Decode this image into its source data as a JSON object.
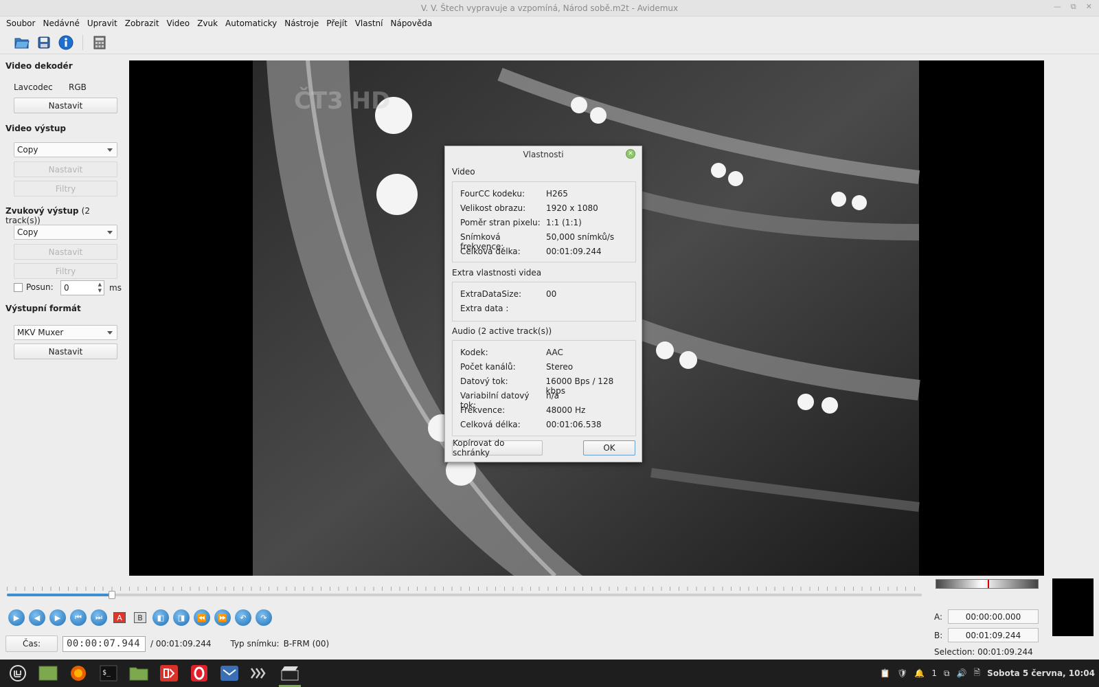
{
  "window": {
    "title": "V. V. Štech vypravuje a vzpomíná, Národ sobě.m2t - Avidemux"
  },
  "menu": [
    "Soubor",
    "Nedávné",
    "Upravit",
    "Zobrazit",
    "Video",
    "Zvuk",
    "Automaticky",
    "Nástroje",
    "Přejít",
    "Vlastní",
    "Nápověda"
  ],
  "left": {
    "video_decoder": {
      "title": "Video dekodér",
      "codec": "Lavcodec",
      "color": "RGB",
      "configure": "Nastavit"
    },
    "video_output": {
      "title": "Video výstup",
      "combo": "Copy",
      "configure": "Nastavit",
      "filters": "Filtry"
    },
    "audio_output": {
      "title": "Zvukový výstup",
      "tracks": "(2 track(s))",
      "combo": "Copy",
      "configure": "Nastavit",
      "filters": "Filtry"
    },
    "shift": {
      "label": "Posun:",
      "value": "0",
      "unit": "ms",
      "checked": false
    },
    "output_format": {
      "title": "Výstupní formát",
      "combo": "MKV Muxer",
      "configure": "Nastavit"
    }
  },
  "dialog": {
    "title": "Vlastnosti",
    "video_section": "Video",
    "video": [
      {
        "k": "FourCC kodeku:",
        "v": "H265"
      },
      {
        "k": "Velikost obrazu:",
        "v": "1920 x 1080"
      },
      {
        "k": "Poměr stran pixelu:",
        "v": "1:1 (1:1)"
      },
      {
        "k": "Snímková frekvence:",
        "v": "50,000 snímků/s"
      },
      {
        "k": "Celková délka:",
        "v": "00:01:09.244"
      }
    ],
    "extra_section": "Extra vlastnosti videa",
    "extra": [
      {
        "k": "ExtraDataSize:",
        "v": "00"
      },
      {
        "k": "Extra data :",
        "v": ""
      }
    ],
    "audio_section": "Audio (2 active track(s))",
    "audio": [
      {
        "k": "Kodek:",
        "v": "AAC"
      },
      {
        "k": "Počet kanálů:",
        "v": "Stereo"
      },
      {
        "k": "Datový tok:",
        "v": "16000 Bps / 128 kbps"
      },
      {
        "k": "Variabilní datový tok:",
        "v": "n/a"
      },
      {
        "k": "Frekvence:",
        "v": "48000 Hz"
      },
      {
        "k": "Celková délka:",
        "v": "00:01:06.538"
      }
    ],
    "copy_button": "Kopírovat do schránky",
    "ok_button": "OK"
  },
  "bottom": {
    "time_button": "Čas:",
    "current_time": "00:00:07.944",
    "total_time": "/ 00:01:09.244",
    "frame_type_label": "Typ snímku:",
    "frame_type": "B-FRM (00)",
    "position": 0.115,
    "a_label": "A:",
    "a_value": "00:00:00.000",
    "b_label": "B:",
    "b_value": "00:01:09.244",
    "selection": "Selection: 00:01:09.244",
    "marker_a": "A",
    "marker_b": "B"
  },
  "taskbar": {
    "clock": "Sobota  5 června, 10:04",
    "notif_count": "1"
  },
  "colors": {
    "accent": "#3d8fd1",
    "taskbar": "#1e1e1e"
  }
}
